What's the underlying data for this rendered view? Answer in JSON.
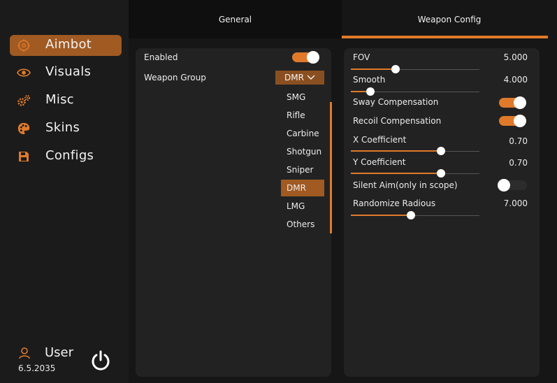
{
  "sidebar": {
    "items": [
      {
        "label": "Aimbot",
        "icon": "crosshair-icon"
      },
      {
        "label": "Visuals",
        "icon": "eye-icon"
      },
      {
        "label": "Misc",
        "icon": "gears-icon"
      },
      {
        "label": "Skins",
        "icon": "palette-icon"
      },
      {
        "label": "Configs",
        "icon": "floppy-disk-icon"
      }
    ],
    "active": "Aimbot",
    "user": {
      "name": "User",
      "version": "6.5.2035"
    }
  },
  "tabs": [
    {
      "label": "General"
    },
    {
      "label": "Weapon Config",
      "active": true
    }
  ],
  "general": {
    "enabled": {
      "label": "Enabled",
      "on": true
    },
    "weapon_group": {
      "label": "Weapon Group",
      "selected": "DMR",
      "options": [
        "SMG",
        "Rifle",
        "Carbine",
        "Shotgun",
        "Sniper",
        "DMR",
        "LMG",
        "Others"
      ]
    }
  },
  "weapon_config": {
    "fov": {
      "label": "FOV",
      "value": "5.000",
      "fraction": 0.35
    },
    "smooth": {
      "label": "Smooth",
      "value": "4.000",
      "fraction": 0.15
    },
    "sway": {
      "label": "Sway Compensation",
      "on": true
    },
    "recoil": {
      "label": "Recoil Compensation",
      "on": true
    },
    "x_coef": {
      "label": "X Coefficient",
      "value": "0.70",
      "fraction": 0.7
    },
    "y_coef": {
      "label": "Y Coefficient",
      "value": "0.70",
      "fraction": 0.7
    },
    "silent_aim": {
      "label": "Silent Aim(only in scope)",
      "on": false
    },
    "randomize": {
      "label": "Randomize Radious",
      "value": "7.000",
      "fraction": 0.47
    }
  },
  "colors": {
    "accent": "#e07a2a",
    "active_nav": "#a05a22",
    "panel": "#222222"
  }
}
